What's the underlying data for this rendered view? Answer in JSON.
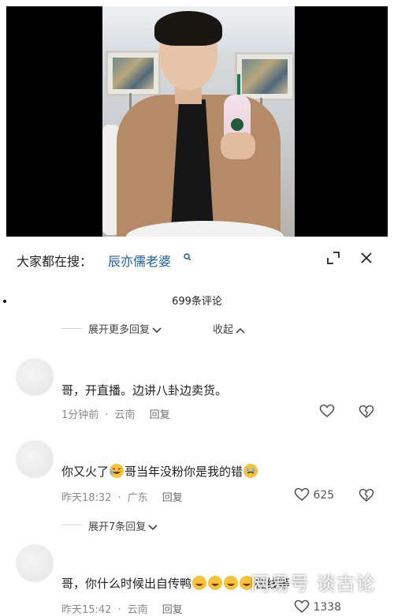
{
  "search": {
    "prefix": "大家都在搜：",
    "term": "辰亦儒老婆"
  },
  "comments_header": {
    "count_label": "699条评论",
    "expand_more_label": "展开更多回复",
    "collapse_label": "收起"
  },
  "comments": [
    {
      "text": "哥，开直播。边讲八卦边卖货。",
      "time": "1分钟前",
      "location": "云南",
      "reply_label": "回复",
      "likes": ""
    },
    {
      "text_before": "你又火了",
      "text_after": "哥当年没粉你是我的错",
      "time": "昨天18:32",
      "location": "广东",
      "reply_label": "回复",
      "likes": "625",
      "more_replies_label": "展开7条回复"
    },
    {
      "text_before": "哥，你什么时候出自传鸭",
      "text_after": "在线等",
      "time": "昨天15:42",
      "location": "云南",
      "reply_label": "回复",
      "likes": "1338"
    }
  ],
  "watermark": "网易号 谈古论",
  "icons": {
    "search": "search-icon",
    "minimize": "minimize-icon",
    "close": "close-icon",
    "like": "heart-icon",
    "dislike": "broken-heart-icon"
  },
  "colors": {
    "search_term": "#1b5fa5",
    "meta": "#8a8a8a"
  }
}
